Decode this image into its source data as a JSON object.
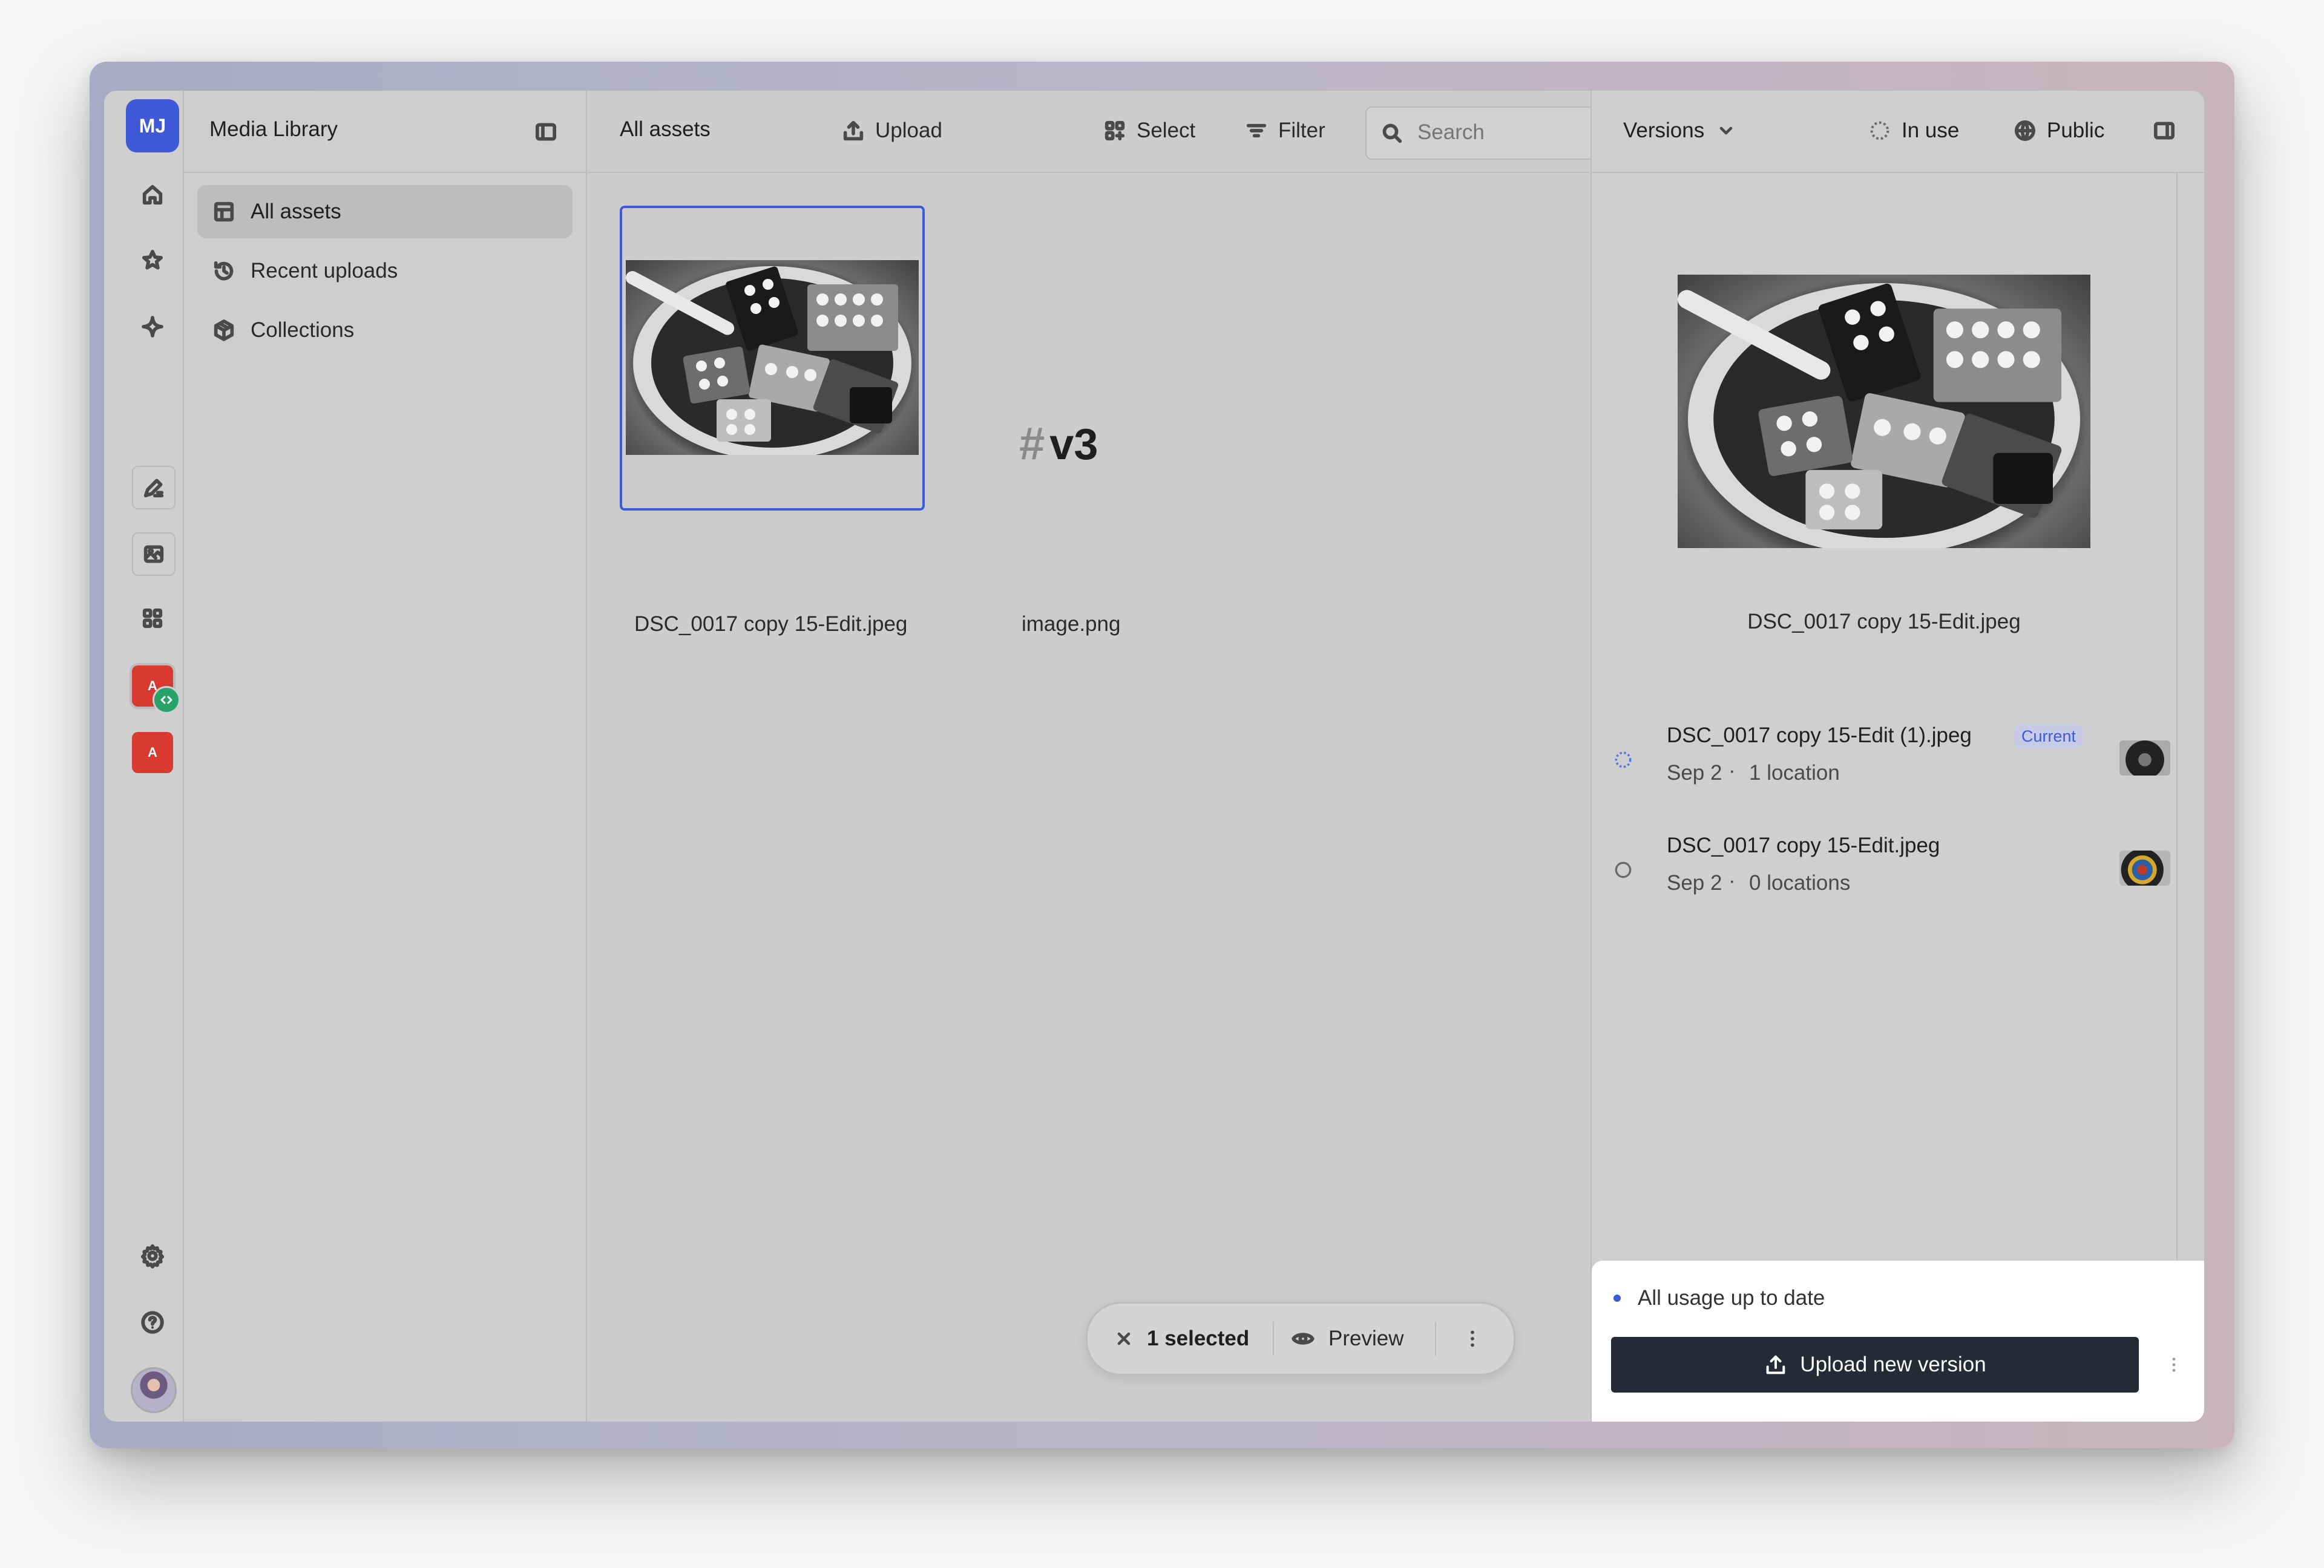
{
  "user": {
    "initials": "MJ"
  },
  "library": {
    "title": "Media Library",
    "nav": [
      {
        "label": "All assets",
        "icon": "grid-layout-icon",
        "active": true
      },
      {
        "label": "Recent uploads",
        "icon": "history-icon",
        "active": false
      },
      {
        "label": "Collections",
        "icon": "box-icon",
        "active": false
      }
    ]
  },
  "rail": {
    "app_badge_letter": "A",
    "icons": [
      "home-icon",
      "star-icon",
      "sparkle-icon",
      "pen-icon",
      "image-icon",
      "apps-grid-icon",
      "app-badge",
      "app-badge",
      "gear-icon",
      "help-icon",
      "avatar"
    ]
  },
  "toolbar": {
    "title": "All assets",
    "upload": "Upload",
    "select": "Select",
    "filter": "Filter",
    "search_placeholder": "Search"
  },
  "assets": [
    {
      "name": "DSC_0017 copy 15-Edit.jpeg",
      "selected": true,
      "kind": "photo"
    },
    {
      "name": "image.png",
      "selected": false,
      "kind": "text",
      "hash": "#",
      "label": "v3"
    }
  ],
  "selection_bar": {
    "count_label": "1 selected",
    "preview_label": "Preview"
  },
  "right_panel": {
    "versions_label": "Versions",
    "in_use_label": "In use",
    "public_label": "Public",
    "preview_name": "DSC_0017 copy 15-Edit.jpeg",
    "versions": [
      {
        "name": "DSC_0017 copy 15-Edit (1).jpeg",
        "badge": "Current",
        "date": "Sep 2",
        "locations": "1 location",
        "status": "loading"
      },
      {
        "name": "DSC_0017 copy 15-Edit.jpeg",
        "badge": "",
        "date": "Sep 2",
        "locations": "0 locations",
        "status": "idle"
      }
    ],
    "usage_status": "All usage up to date",
    "upload_new_version": "Upload new version"
  },
  "colors": {
    "accent": "#3b5bdb",
    "dark_button": "#262a36",
    "app_red": "#d93a2f",
    "badge_green": "#27a36a"
  }
}
